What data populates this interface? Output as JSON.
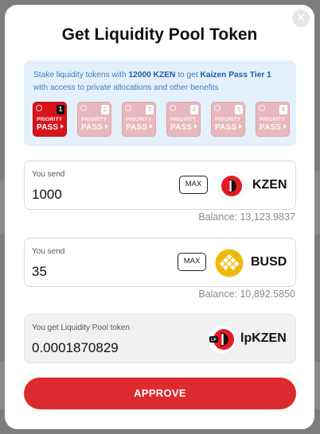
{
  "modal": {
    "title": "Get Liquidity Pool Token",
    "close_glyph": "×"
  },
  "info": {
    "text_prefix": "Stake liquidity tokens with ",
    "amount": "12000 KZEN",
    "text_middle": " to get ",
    "tier": "Kaizen Pass Tier 1",
    "text_suffix": " with access to private allocations and other benefits",
    "passes": [
      {
        "tier": "1",
        "line1": "PRIORITY",
        "line2": "PASS",
        "active": true
      },
      {
        "tier": "2",
        "line1": "PRIORITY",
        "line2": "PASS",
        "active": false
      },
      {
        "tier": "3",
        "line1": "PRIORITY",
        "line2": "PASS",
        "active": false
      },
      {
        "tier": "4",
        "line1": "PRIORITY",
        "line2": "PASS",
        "active": false
      },
      {
        "tier": "5",
        "line1": "PRIORITY",
        "line2": "PASS",
        "active": false
      },
      {
        "tier": "6",
        "line1": "PRIORITY",
        "line2": "PASS",
        "active": false
      }
    ]
  },
  "send1": {
    "label": "You send",
    "value": "1000",
    "max_label": "MAX",
    "token": "KZEN",
    "icon": "kzen-token-icon",
    "balance": "Balance: 13,123.9837"
  },
  "send2": {
    "label": "You send",
    "value": "35",
    "max_label": "MAX",
    "token": "BUSD",
    "icon": "busd-token-icon",
    "balance": "Balance: 10,892.5850"
  },
  "receive": {
    "label": "You get Liquidity Pool token",
    "value": "0.0001870829",
    "token": "lpKZEN",
    "icon": "lpkzen-token-icon"
  },
  "approve": {
    "label": "APPROVE"
  },
  "colors": {
    "accent": "#dc2a2e",
    "info_bg": "#e4f0fb",
    "info_text": "#3d7fc1",
    "busd": "#f0b90b"
  }
}
